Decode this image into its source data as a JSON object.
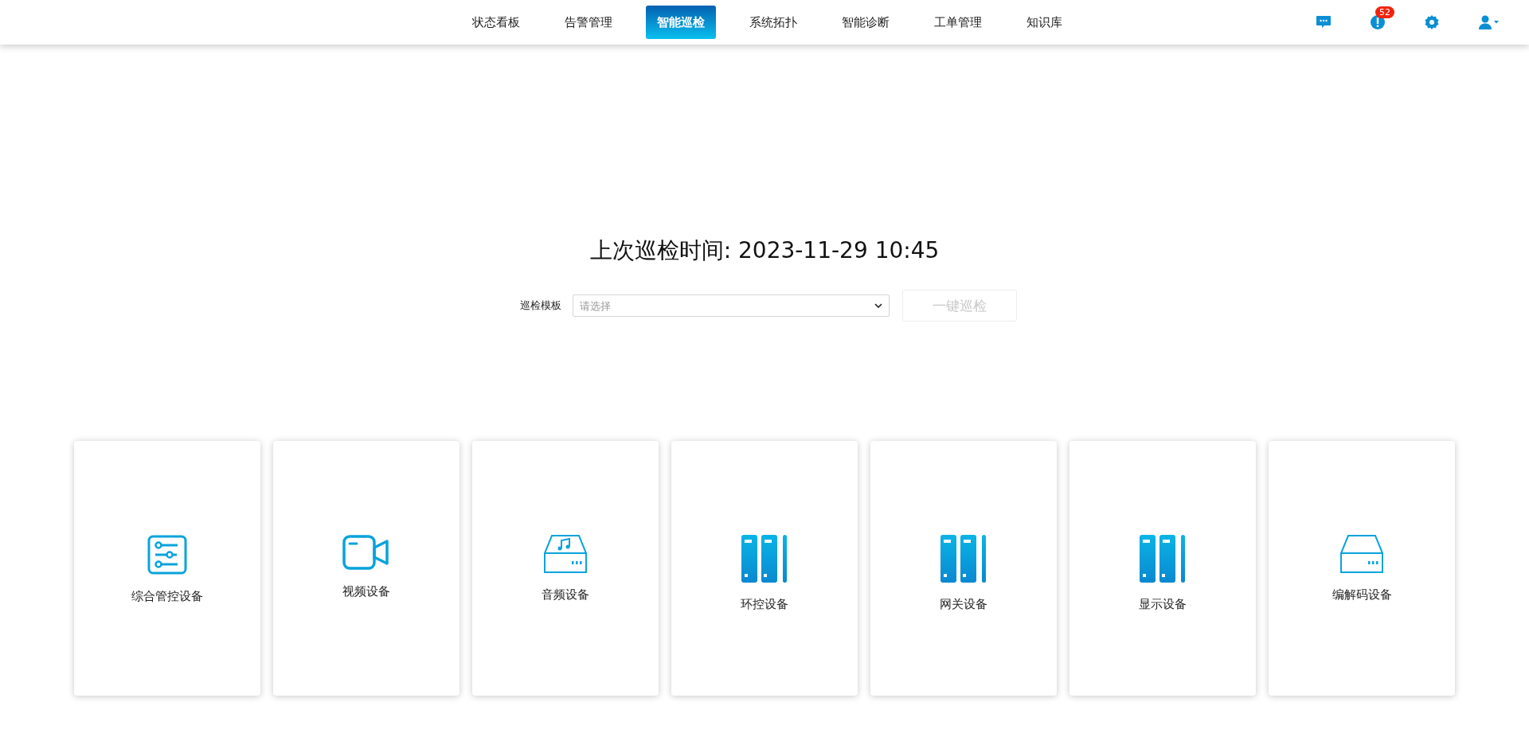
{
  "nav": {
    "tabs": [
      {
        "label": "状态看板",
        "selected": false
      },
      {
        "label": "告警管理",
        "selected": false
      },
      {
        "label": "智能巡检",
        "selected": true
      },
      {
        "label": "系统拓扑",
        "selected": false
      },
      {
        "label": "智能诊断",
        "selected": false
      },
      {
        "label": "工单管理",
        "selected": false
      },
      {
        "label": "知识库",
        "selected": false
      }
    ],
    "alert_count": "52"
  },
  "last_inspection": "上次巡检时间: 2023-11-29 10:45",
  "template": {
    "label": "巡检模板",
    "placeholder": "请选择"
  },
  "run_button": {
    "label": "一键巡检",
    "disabled": true
  },
  "devices": [
    {
      "name": "综合管控设备",
      "kind": "sliders"
    },
    {
      "name": "视频设备",
      "kind": "camera"
    },
    {
      "name": "音频设备",
      "kind": "audio"
    },
    {
      "name": "环控设备",
      "kind": "rack"
    },
    {
      "name": "网关设备",
      "kind": "rack"
    },
    {
      "name": "显示设备",
      "kind": "rack"
    },
    {
      "name": "编解码设备",
      "kind": "drive"
    }
  ]
}
